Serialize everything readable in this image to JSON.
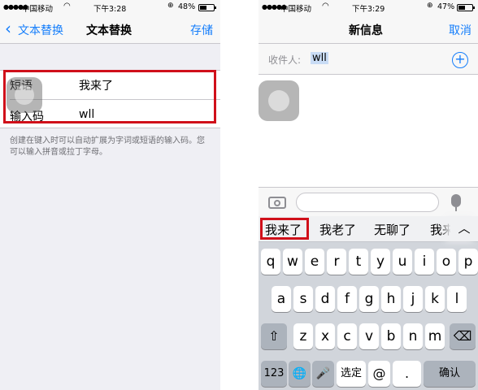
{
  "left": {
    "status": {
      "carrier": "中国移动",
      "time": "下午3:28",
      "battery": "48%",
      "battery_level": 0.48
    },
    "nav": {
      "back_label": "文本替换",
      "title": "文本替换",
      "save_label": "存储"
    },
    "form": {
      "phrase_label": "短语",
      "phrase_value": "我来了",
      "shortcut_label": "输入码",
      "shortcut_value": "wll"
    },
    "hint": "创建在键入时可以自动扩展为字词或短语的输入码。您可以输入拼音或拉丁字母。"
  },
  "right": {
    "status": {
      "carrier": "中国移动",
      "time": "下午3:29",
      "battery": "47%",
      "battery_level": 0.47
    },
    "nav": {
      "title": "新信息",
      "cancel_label": "取消"
    },
    "recipient": {
      "label": "收件人:",
      "value": "wll"
    },
    "candidates": [
      "我来了",
      "我老了",
      "无聊了",
      "我来"
    ],
    "keyboard": {
      "row1": [
        "q",
        "w",
        "e",
        "r",
        "t",
        "y",
        "u",
        "i",
        "o",
        "p"
      ],
      "row2": [
        "a",
        "s",
        "d",
        "f",
        "g",
        "h",
        "j",
        "k",
        "l"
      ],
      "row3": [
        "z",
        "x",
        "c",
        "v",
        "b",
        "n",
        "m"
      ],
      "numbers_label": "123",
      "select_label": "选定",
      "at_label": "@",
      "dot_label": ".",
      "confirm_label": "确认"
    }
  }
}
